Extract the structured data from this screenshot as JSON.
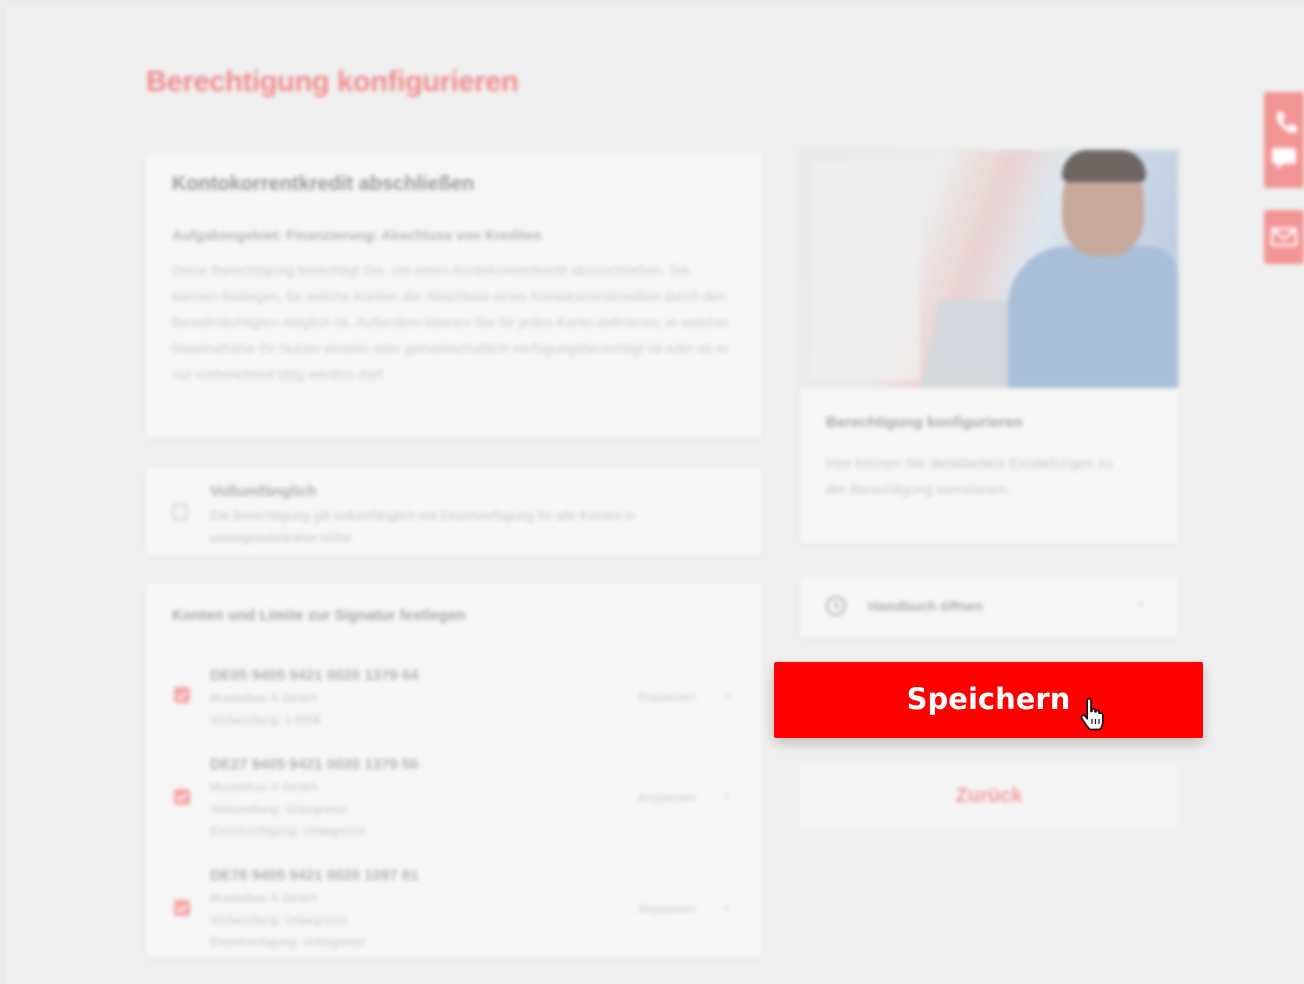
{
  "page": {
    "title": "Berechtigung konfigurieren"
  },
  "permission": {
    "title": "Kontokorrentkredit abschließen",
    "subtitle": "Aufgabengebiet: Finanzierung: Abschluss von Krediten",
    "description": "Diese Berechtigung berechtigt Sie, um einen Kontokorrentkredit abzuschließen. Sie können festlegen, für welche Konten der Abschluss eines Kontokorrentkredites durch den Bevollmächtigten möglich ist. Außerdem können Sie für jedes Konto definieren, in welcher Maximalhöhe Ihr Nutzer einzeln oder gemeinschaftlich verfügungsberechtigt ist oder ob er nur vorbereitend tätig werden darf."
  },
  "full_scope": {
    "title": "Vollumfänglich",
    "text": "Die Berechtigung gilt vollumfänglich mit Einzelverfügung für alle Konten in uneingeschränkter Höhe",
    "checked": false
  },
  "accounts": {
    "heading": "Konten und Limite zur Signatur festlegen",
    "show_label": "Anpassen",
    "items": [
      {
        "iban": "DE05 9405 9421 0020 1379 64",
        "owner": "Musterfrau X GmbH",
        "limit1": "Vorbereitung: 1.000€",
        "limit2": "",
        "checked": true
      },
      {
        "iban": "DE27 9405 9421 0020 1379 56",
        "owner": "Musterfrau X GmbH",
        "limit1": "Vorbereitung: Unbegrenzt",
        "limit2": "Einzelverfügung: Unbegrenzt",
        "checked": true
      },
      {
        "iban": "DE78 9405 9421 0020 1097 81",
        "owner": "Musterfrau X GmbH",
        "limit1": "Vorbereitung: Unbegrenzt",
        "limit2": "Einzelverfügung: Unbegrenzt",
        "checked": true
      }
    ]
  },
  "info_card": {
    "title": "Berechtigung konfigurieren",
    "text": "Hier können Sie detailliertere Einstellungen zu der Berechtigung vornehmen."
  },
  "manual": {
    "label": "Handbuch öffnen",
    "icon": "clock-icon"
  },
  "actions": {
    "save_label": "Speichern",
    "back_label": "Zurück"
  },
  "colors": {
    "accent": "#ff0000",
    "accent_faded": "#f29494"
  }
}
